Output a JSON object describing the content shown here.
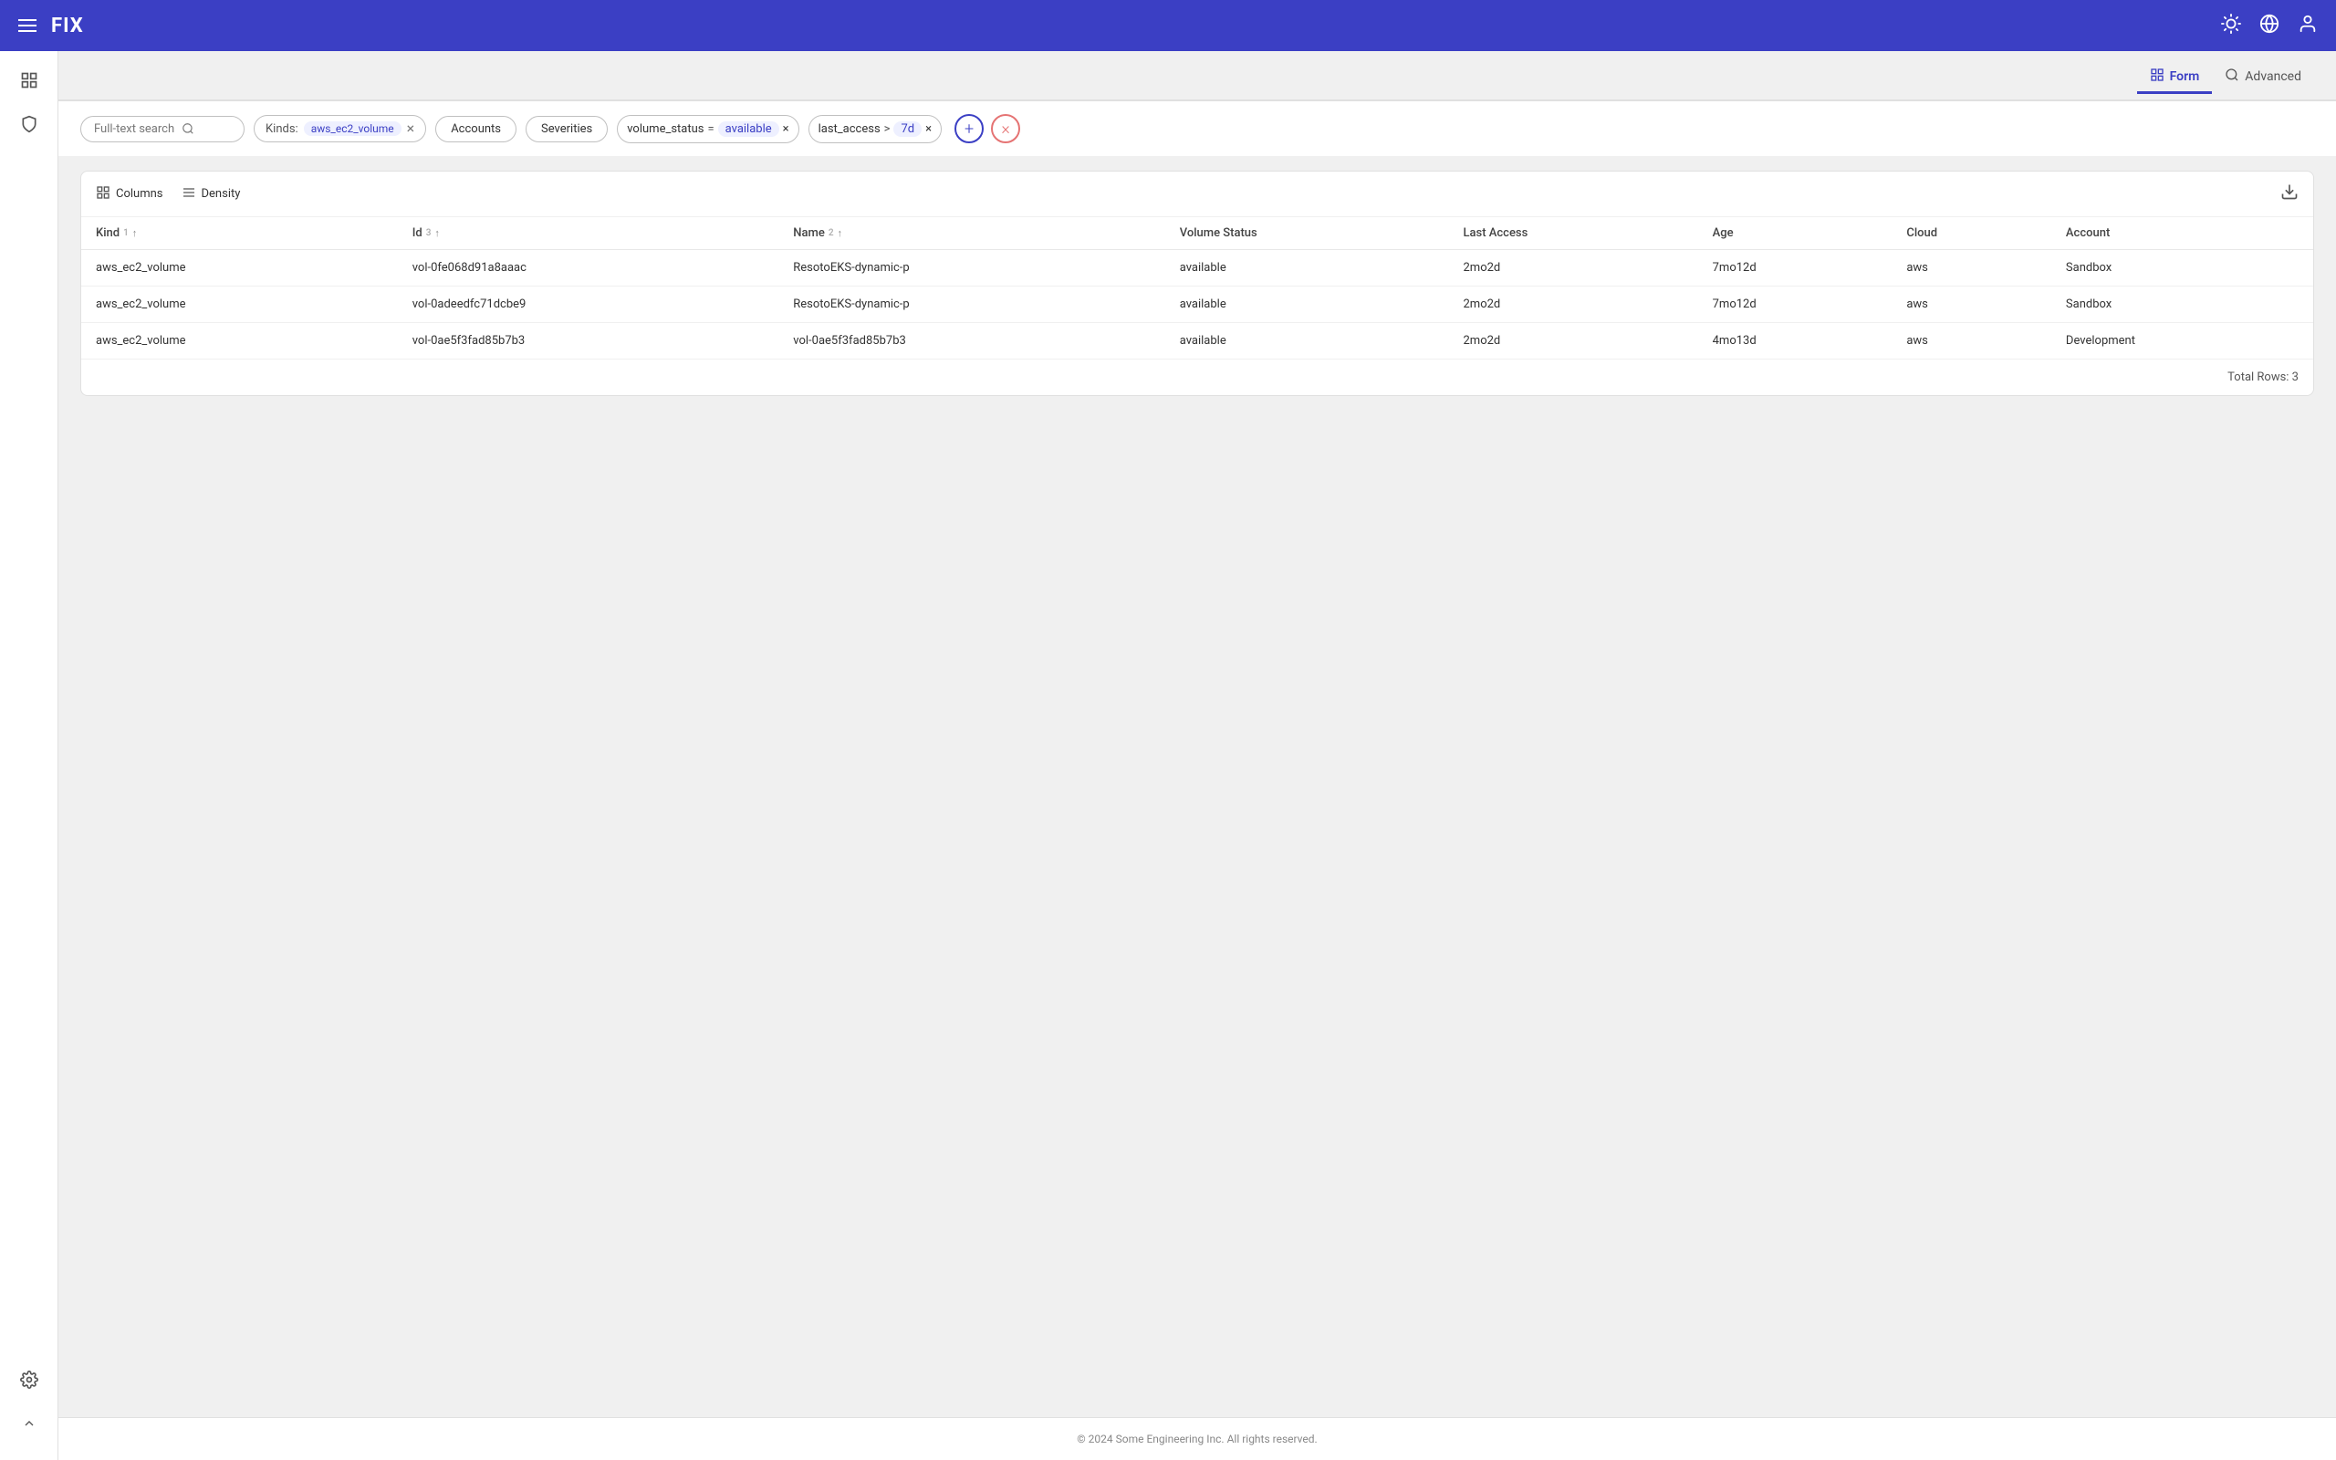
{
  "app": {
    "title": "FIX",
    "footer": "© 2024 Some Engineering Inc. All rights reserved."
  },
  "navbar": {
    "menu_label": "menu",
    "theme_icon": "☀",
    "globe_icon": "🌐",
    "user_icon": "👤"
  },
  "sidebar": {
    "items": [
      {
        "name": "database-icon",
        "icon": "▤"
      },
      {
        "name": "shield-icon",
        "icon": "🛡"
      }
    ],
    "bottom_items": [
      {
        "name": "settings-icon",
        "icon": "⚙"
      },
      {
        "name": "collapse-icon",
        "icon": "⌃"
      }
    ]
  },
  "view_tabs": [
    {
      "id": "form",
      "label": "Form",
      "icon": "▦",
      "active": true
    },
    {
      "id": "advanced",
      "label": "Advanced",
      "icon": "🔍",
      "active": false
    }
  ],
  "filters": {
    "search_placeholder": "Full-text search",
    "search_icon": "🔍",
    "kind_label": "Kinds:",
    "kind_value": "aws_ec2_volume",
    "accounts_label": "Accounts",
    "severities_label": "Severities",
    "volume_status_key": "volume_status",
    "volume_status_operator": "=",
    "volume_status_value": "available",
    "last_access_key": "last_access",
    "last_access_operator": ">",
    "last_access_value": "7d",
    "add_filter_label": "+",
    "clear_filter_label": "×"
  },
  "table": {
    "columns_label": "Columns",
    "density_label": "Density",
    "columns_icon": "▦",
    "density_icon": "☰",
    "download_icon": "⬇",
    "headers": [
      {
        "label": "Kind",
        "sort_num": "1",
        "sort_arrow": "↑"
      },
      {
        "label": "Id",
        "sort_num": "3",
        "sort_arrow": "↑"
      },
      {
        "label": "Name",
        "sort_num": "2",
        "sort_arrow": "↑"
      },
      {
        "label": "Volume Status",
        "sort_num": "",
        "sort_arrow": ""
      },
      {
        "label": "Last Access",
        "sort_num": "",
        "sort_arrow": ""
      },
      {
        "label": "Age",
        "sort_num": "",
        "sort_arrow": ""
      },
      {
        "label": "Cloud",
        "sort_num": "",
        "sort_arrow": ""
      },
      {
        "label": "Account",
        "sort_num": "",
        "sort_arrow": ""
      }
    ],
    "rows": [
      {
        "kind": "aws_ec2_volume",
        "id": "vol-0fe068d91a8aaac",
        "name": "ResotoEKS-dynamic-p",
        "volume_status": "available",
        "last_access": "2mo2d",
        "age": "7mo12d",
        "cloud": "aws",
        "account": "Sandbox"
      },
      {
        "kind": "aws_ec2_volume",
        "id": "vol-0adeedfc71dcbe9",
        "name": "ResotoEKS-dynamic-p",
        "volume_status": "available",
        "last_access": "2mo2d",
        "age": "7mo12d",
        "cloud": "aws",
        "account": "Sandbox"
      },
      {
        "kind": "aws_ec2_volume",
        "id": "vol-0ae5f3fad85b7b3",
        "name": "vol-0ae5f3fad85b7b3",
        "volume_status": "available",
        "last_access": "2mo2d",
        "age": "4mo13d",
        "cloud": "aws",
        "account": "Development"
      }
    ],
    "total_rows_label": "Total Rows: 3"
  },
  "colors": {
    "brand": "#3b3fc4",
    "navbar_bg": "#3b3fc4",
    "accent": "#3b3fc4",
    "clear_red": "#e57373"
  }
}
